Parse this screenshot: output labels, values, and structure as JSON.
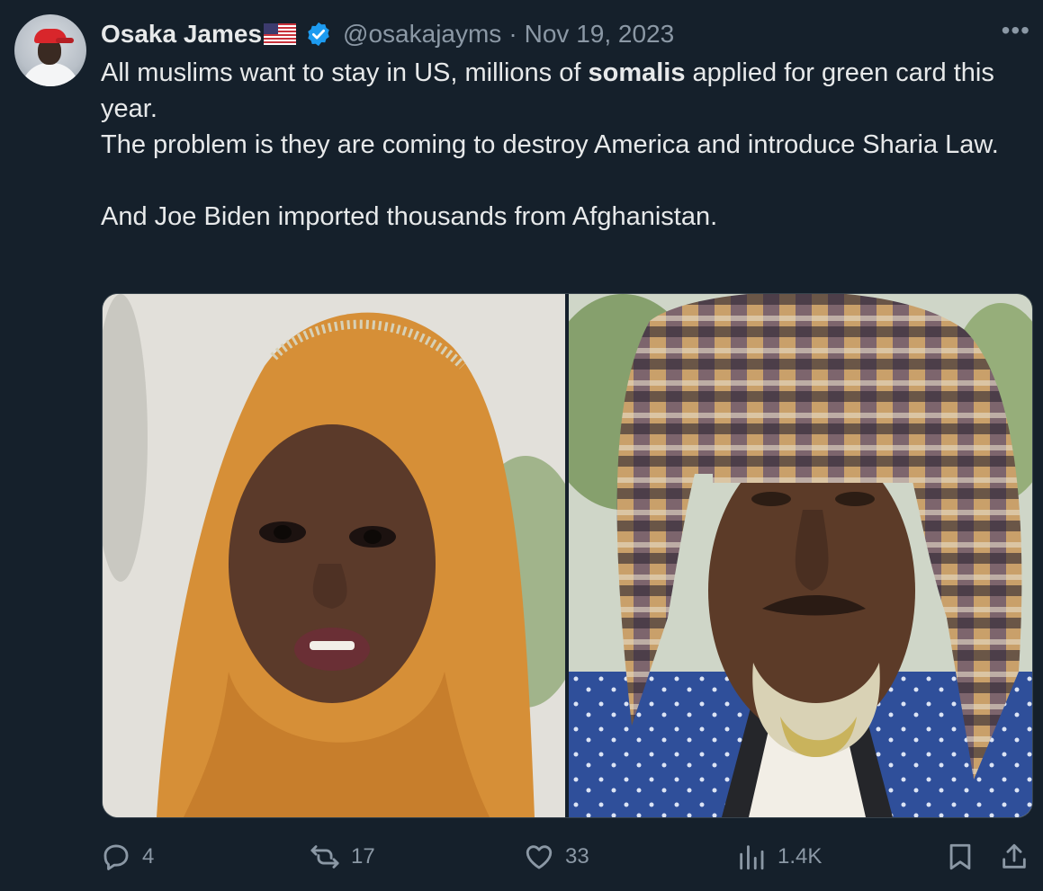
{
  "author": {
    "name": "Osaka James",
    "flag": "🇺🇸",
    "verified": true,
    "handle": "@osakajayms",
    "separator": "·",
    "date": "Nov 19, 2023"
  },
  "more_label": "•••",
  "tweet": {
    "line1_a": "All muslims  want to stay in US, millions of ",
    "line1_bold": "somalis",
    "line1_b": " applied for green card this year.",
    "line2": "The problem is they are coming to destroy America and introduce Sharia Law.",
    "line3": "And Joe Biden imported thousands from Afghanistan."
  },
  "media": [
    {
      "name": "photo-woman-hijab"
    },
    {
      "name": "photo-man-headwrap"
    }
  ],
  "actions": {
    "replies": {
      "icon": "reply-icon",
      "count": "4"
    },
    "reposts": {
      "icon": "repost-icon",
      "count": "17"
    },
    "likes": {
      "icon": "heart-icon",
      "count": "33"
    },
    "views": {
      "icon": "views-icon",
      "count": "1.4K"
    },
    "bookmark": {
      "icon": "bookmark-icon"
    },
    "share": {
      "icon": "share-icon"
    }
  },
  "colors": {
    "background": "#15202b",
    "text": "#e7e9ea",
    "muted": "#8b98a5",
    "verified": "#1d9bf0",
    "border": "#38444d"
  }
}
